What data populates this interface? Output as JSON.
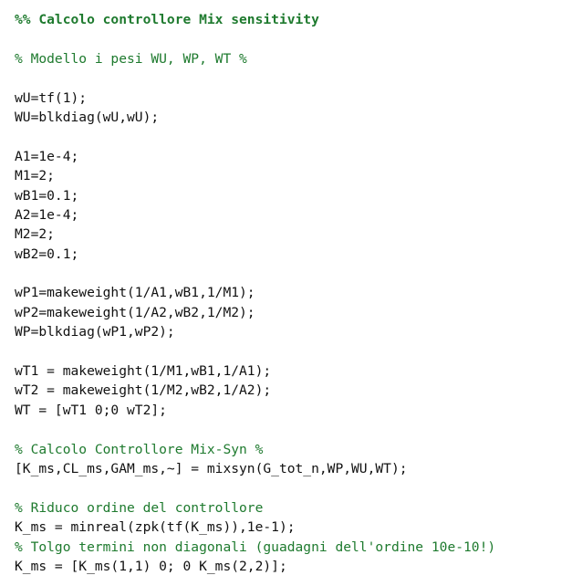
{
  "editor": {
    "colors": {
      "background": "#ffffff",
      "code": "#111111",
      "comment": "#1e7a2e"
    },
    "lines": [
      {
        "kind": "cell-header",
        "text": "%% Calcolo controllore Mix sensitivity"
      },
      {
        "kind": "blank",
        "text": ""
      },
      {
        "kind": "comment",
        "text": "% Modello i pesi WU, WP, WT %"
      },
      {
        "kind": "blank",
        "text": ""
      },
      {
        "kind": "code",
        "text": "wU=tf(1);"
      },
      {
        "kind": "code",
        "text": "WU=blkdiag(wU,wU);"
      },
      {
        "kind": "blank",
        "text": ""
      },
      {
        "kind": "code",
        "text": "A1=1e-4;"
      },
      {
        "kind": "code",
        "text": "M1=2;"
      },
      {
        "kind": "code",
        "text": "wB1=0.1;"
      },
      {
        "kind": "code",
        "text": "A2=1e-4;"
      },
      {
        "kind": "code",
        "text": "M2=2;"
      },
      {
        "kind": "code",
        "text": "wB2=0.1;"
      },
      {
        "kind": "blank",
        "text": ""
      },
      {
        "kind": "code",
        "text": "wP1=makeweight(1/A1,wB1,1/M1);"
      },
      {
        "kind": "code",
        "text": "wP2=makeweight(1/A2,wB2,1/M2);"
      },
      {
        "kind": "code",
        "text": "WP=blkdiag(wP1,wP2);"
      },
      {
        "kind": "blank",
        "text": ""
      },
      {
        "kind": "code",
        "text": "wT1 = makeweight(1/M1,wB1,1/A1);"
      },
      {
        "kind": "code",
        "text": "wT2 = makeweight(1/M2,wB2,1/A2);"
      },
      {
        "kind": "code",
        "text": "WT = [wT1 0;0 wT2];"
      },
      {
        "kind": "blank",
        "text": ""
      },
      {
        "kind": "comment",
        "text": "% Calcolo Controllore Mix-Syn %"
      },
      {
        "kind": "code",
        "text": "[K_ms,CL_ms,GAM_ms,~] = mixsyn(G_tot_n,WP,WU,WT);"
      },
      {
        "kind": "blank",
        "text": ""
      },
      {
        "kind": "comment",
        "text": "% Riduco ordine del controllore"
      },
      {
        "kind": "code",
        "text": "K_ms = minreal(zpk(tf(K_ms)),1e-1);"
      },
      {
        "kind": "comment",
        "text": "% Tolgo termini non diagonali (guadagni dell'ordine 10e-10!)"
      },
      {
        "kind": "code",
        "text": "K_ms = [K_ms(1,1) 0; 0 K_ms(2,2)];"
      }
    ]
  }
}
